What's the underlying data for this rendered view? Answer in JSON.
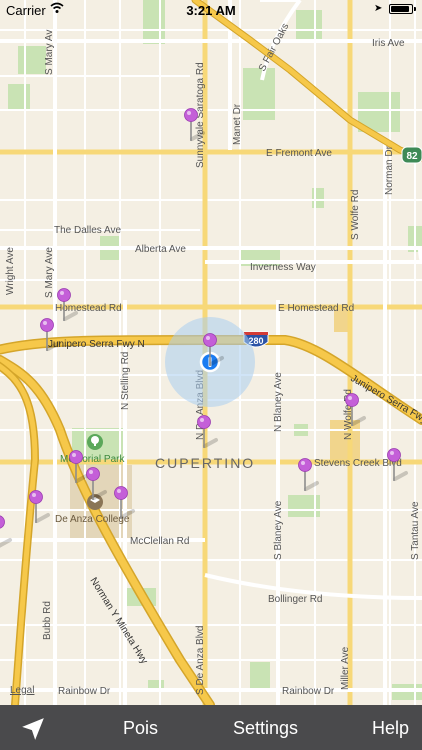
{
  "status_bar": {
    "carrier": "Carrier",
    "time": "3:21 AM",
    "battery_level": 0.9,
    "wifi_icon": "wifi-icon",
    "location_icon": "location-arrow-icon"
  },
  "map": {
    "city_label": "CUPERTINO",
    "legal": "Legal",
    "streets": {
      "s_mary": "S Mary Av",
      "s_mary_ave": "S Mary Ave",
      "s_fair_oaks": "S Fair Oaks",
      "iris": "Iris Ave",
      "sunnyvale_saratoga": "Sunnyvale Saratoga Rd",
      "manet": "Manet Dr",
      "e_fremont": "E Fremont Ave",
      "route_82": "82",
      "norman_dr": "Norman Dr",
      "s_wolfe": "S Wolfe Rd",
      "the_dalles": "The Dalles Ave",
      "alberta": "Alberta Ave",
      "inverness": "Inverness Way",
      "wright": "Wright Ave",
      "homestead": "Homestead Rd",
      "e_homestead": "E Homestead Rd",
      "junipero_n": "Junipero Serra Fwy N",
      "i280": "280",
      "n_stelling": "N Stelling Rd",
      "n_de_anza": "N De Anza Blvd",
      "n_blaney": "N Blaney Ave",
      "junipero_s": "Junipero Serra Fwy",
      "n_wolfe": "N Wolfe Rd",
      "memorial_park": "Memorial Park",
      "stevens_creek": "Stevens Creek Blvd",
      "de_anza_college": "De Anza College",
      "mcclellan": "McClellan Rd",
      "s_blaney": "S Blaney Ave",
      "s_tantau": "S Tantau Ave",
      "norman_mineta": "Norman Y Mineta Hwy",
      "bollinger": "Bollinger Rd",
      "bubb": "Bubb Rd",
      "s_de_anza": "S De Anza Blvd",
      "miller": "Miller Ave",
      "rainbow_w": "Rainbow Dr",
      "rainbow_e": "Rainbow Dr"
    },
    "pin_icon": "map-pin-icon",
    "pin_color": "#c45fd8",
    "user_location_icon": "user-location-icon",
    "user_location_color": "#1a7cf2"
  },
  "toolbar": {
    "nav_icon": "navigation-arrow-icon",
    "pois_label": "Pois",
    "settings_label": "Settings",
    "help_label": "Help"
  }
}
